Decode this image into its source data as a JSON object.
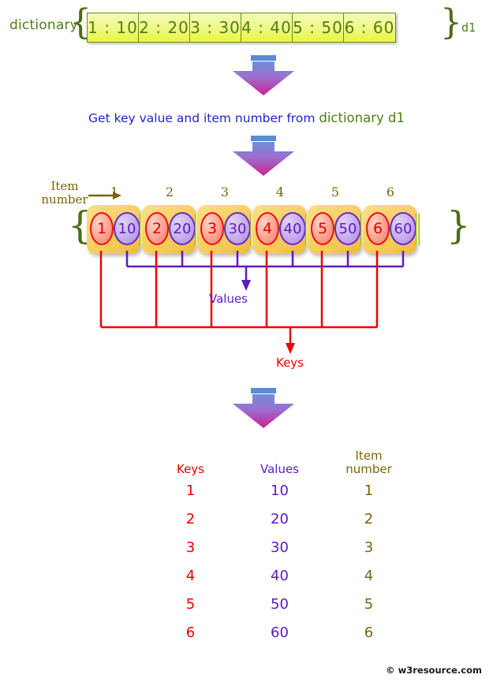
{
  "top": {
    "label": "dictionary",
    "variable": "d1",
    "brace_open": "{",
    "brace_close": "}",
    "cells": [
      "1 : 10",
      "2 : 20",
      "3 : 30",
      "4 : 40",
      "5 : 50",
      "6 : 60"
    ]
  },
  "caption": {
    "text_blue": "Get key value and item number from ",
    "text_green": "dictionary d1"
  },
  "middle": {
    "item_number_label_line1": "Item",
    "item_number_label_line2": "number",
    "item_numbers": [
      "1",
      "2",
      "3",
      "4",
      "5",
      "6"
    ],
    "brace_open": "{",
    "brace_close": "}",
    "pairs": [
      {
        "key": "1",
        "colon": ":",
        "value": "10"
      },
      {
        "key": "2",
        "colon": ":",
        "value": "20"
      },
      {
        "key": "3",
        "colon": ":",
        "value": "30"
      },
      {
        "key": "4",
        "colon": ":",
        "value": "40"
      },
      {
        "key": "5",
        "colon": ":",
        "value": "50"
      },
      {
        "key": "6",
        "colon": ":",
        "value": "60"
      }
    ],
    "values_label": "Values",
    "keys_label": "Keys"
  },
  "result": {
    "headers": {
      "keys": "Keys",
      "values": "Values",
      "item_number_line1": "Item",
      "item_number_line2": "number"
    },
    "rows": [
      {
        "key": "1",
        "value": "10",
        "item": "1"
      },
      {
        "key": "2",
        "value": "20",
        "item": "2"
      },
      {
        "key": "3",
        "value": "30",
        "item": "3"
      },
      {
        "key": "4",
        "value": "40",
        "item": "4"
      },
      {
        "key": "5",
        "value": "50",
        "item": "5"
      },
      {
        "key": "6",
        "value": "60",
        "item": "6"
      }
    ]
  },
  "footer": {
    "copyright": "© w3resource.com"
  },
  "colors": {
    "keys": "#ee0000",
    "values": "#5c1bbf",
    "item_number": "#7a6409",
    "dictionary_green": "#4f7d18",
    "caption_blue": "#2222cc",
    "cell_fill": "#eff893",
    "pair_box_fill": "#f6cf63",
    "arrow_top": "#5b8ad6",
    "arrow_bottom": "#cc2a9a"
  }
}
